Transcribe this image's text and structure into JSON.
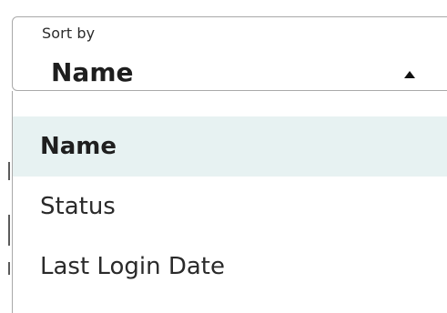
{
  "sort_select": {
    "legend": "Sort by",
    "selected_value": "Name",
    "arrow_icon": "arrow-up-icon",
    "options": [
      {
        "label": "Name",
        "selected": true
      },
      {
        "label": "Status",
        "selected": false
      },
      {
        "label": "Last Login Date",
        "selected": false
      }
    ]
  },
  "colors": {
    "selected_option_bg": "#e7f2f2",
    "border": "#a9a9a9"
  }
}
